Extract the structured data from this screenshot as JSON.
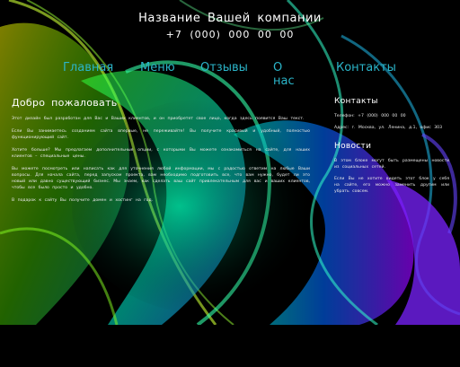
{
  "header": {
    "company": "Название Вашей компании",
    "phone": "+7 (000) 000 00 00"
  },
  "nav": {
    "items": [
      "Главная",
      "Меню",
      "Отзывы",
      "О нас",
      "Контакты"
    ]
  },
  "main": {
    "title": "Добро пожаловать",
    "paragraphs": [
      "Этот дизайн был разработан для Вас и Ваших клиентов, и он приобретет свое лицо, когда здесь появится Ваш текст.",
      "Если Вы занимаетесь созданием сайта впервые, не переживайте! Вы получите красивый и удобный, полностью функционирующий сайт.",
      "Хотите больше? Мы предлагаем дополнительные опции, с которыми Вы можете ознакомиться на сайте, для наших клиентов – специальные цены.",
      "Вы можете посмотреть или написать как для уточнения любой информации, мы с радостью ответим на любые Ваши вопросы. Для начала сайта, перед запуском проекта, вам необходимо подготовить все, что вам нужно, будет ли это новый или давно существующий бизнес. Мы знаем, как сделать ваш сайт привлекательным для вас и ваших клиентов, чтобы все было просто и удобно.",
      "В подарок к сайту Вы получите домен и хостинг на год."
    ]
  },
  "side": {
    "contacts_title": "Контакты",
    "contacts": [
      "Телефон: +7 (000) 000 00 00",
      "Адрес: г. Москва, ул. Ленина, д.1, офис 303"
    ],
    "news_title": "Новости",
    "news": [
      "В этом блоке могут быть размещены новости из социальных сетей.",
      "Если Вы не хотите видеть этот блок у себя на сайте, его можно заменить другим или убрать совсем."
    ]
  },
  "colors": {
    "nav_link": "#2bb5c9",
    "background": "#000000"
  }
}
